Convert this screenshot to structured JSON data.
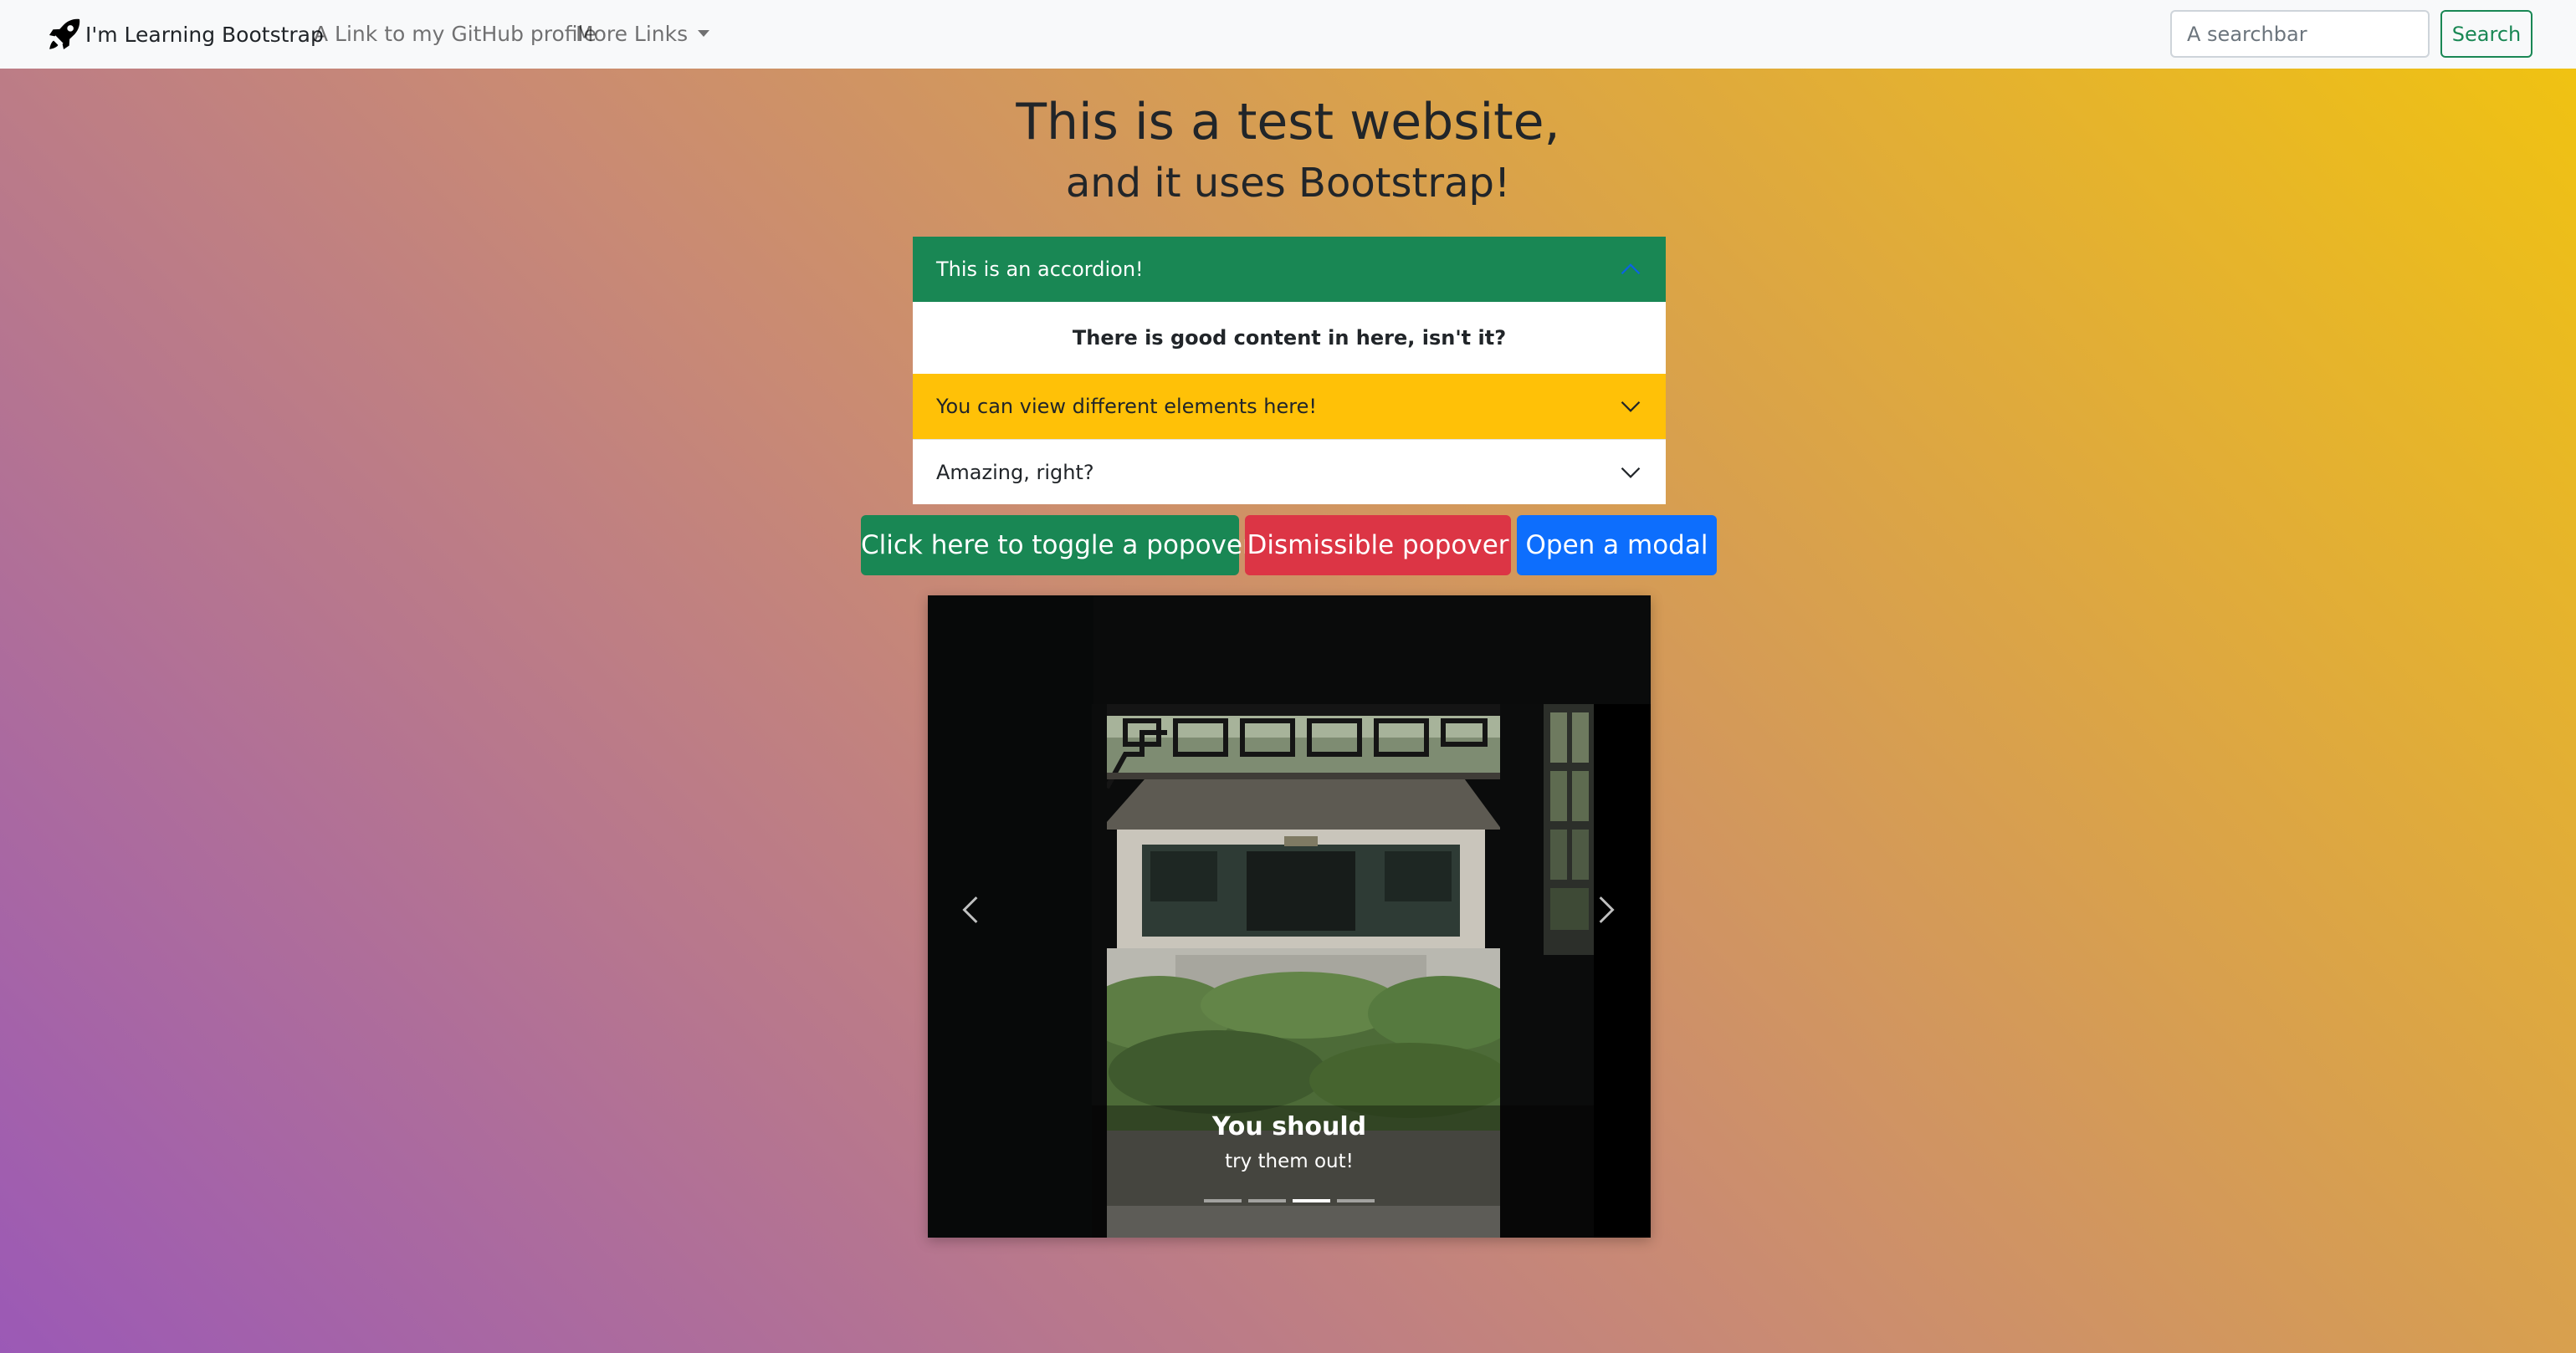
{
  "navbar": {
    "brand_icon": "rocket-icon",
    "brand": "I'm Learning Bootstrap",
    "github_link": "A Link to my GitHub profile",
    "more_links": "More Links",
    "search_placeholder": "A searchbar",
    "search_button": "Search"
  },
  "hero": {
    "title": "This is a test website,",
    "subtitle": "and it uses Bootstrap!"
  },
  "accordion": {
    "items": [
      {
        "header": "This is an accordion!",
        "expanded": true,
        "body": "There is good content in here, isn't it?"
      },
      {
        "header": "You can view different elements here!",
        "expanded": false
      },
      {
        "header": "Amazing, right?",
        "expanded": false
      }
    ]
  },
  "buttons": {
    "popover": "Click here to toggle a popover",
    "dismissible": "Dismissible popover",
    "modal": "Open a modal"
  },
  "carousel": {
    "caption_title": "You should",
    "caption_text": "try them out!",
    "slide_count": 4,
    "active_slide": 3
  },
  "colors": {
    "success": "#198754",
    "warning": "#ffc107",
    "danger": "#dc3545",
    "primary": "#0d6efd",
    "background_gradient": [
      "#9b59b6",
      "#f1c40f"
    ]
  }
}
